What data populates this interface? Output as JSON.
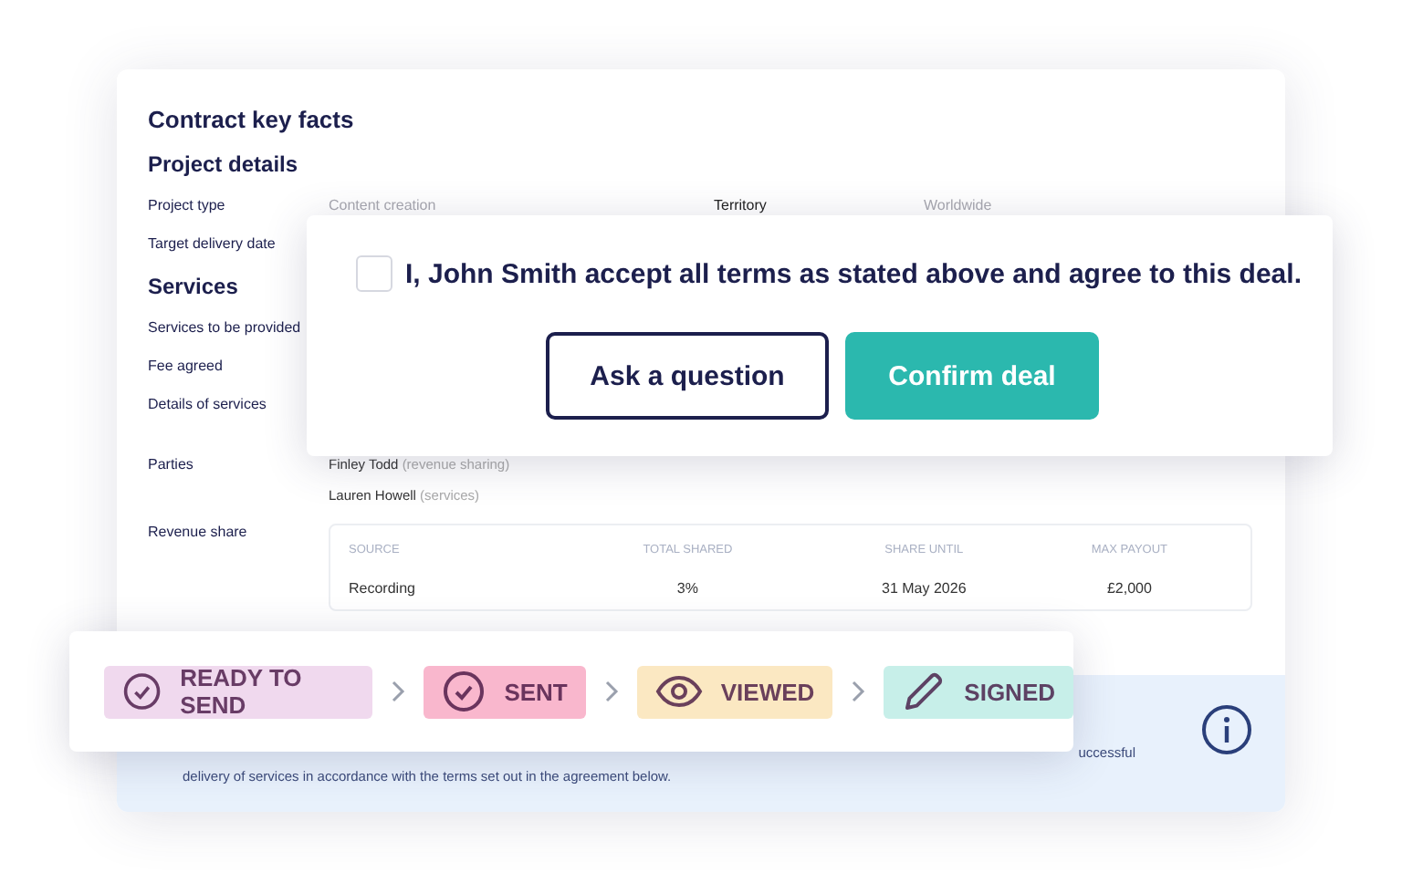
{
  "card": {
    "title": "Contract key facts",
    "sections": [
      {
        "heading": "Project details",
        "rows": [
          {
            "label": "Project type",
            "value": "Content creation",
            "extra_label": "Territory",
            "extra_value": "Worldwide"
          },
          {
            "label": "Target delivery date"
          }
        ]
      },
      {
        "heading": "Services",
        "rows": [
          {
            "label": "Services to be provided"
          },
          {
            "label": "Fee agreed"
          },
          {
            "label": "Details of services"
          }
        ]
      }
    ],
    "parties_label": "Parties",
    "parties": [
      {
        "name": "Finley Todd",
        "role": "(revenue sharing)"
      },
      {
        "name": "Lauren Howell",
        "role": "(services)"
      }
    ],
    "revenue_label": "Revenue share",
    "revenue_table": {
      "columns": [
        "SOURCE",
        "TOTAL SHARED",
        "SHARE UNTIL",
        "MAX PAYOUT"
      ],
      "rows": [
        [
          "Recording",
          "3%",
          "31 May 2026",
          "£2,000"
        ]
      ]
    },
    "info": {
      "line_end": "uccessful",
      "line": "delivery of services in accordance with the terms set out in the agreement below."
    }
  },
  "accept_dialog": {
    "checked": false,
    "statement": "I, John Smith accept all terms as stated above and agree to this deal.",
    "buttons": [
      {
        "label": "Ask a question",
        "kind": "outline"
      },
      {
        "label": "Confirm deal",
        "kind": "primary"
      }
    ]
  },
  "status_steps": [
    {
      "label": "READY TO SEND",
      "kind": "check",
      "color": "#f0d9ee"
    },
    {
      "label": "SENT",
      "kind": "check",
      "color": "#f9b7cd"
    },
    {
      "label": "VIEWED",
      "kind": "eye",
      "color": "#fbe8c2"
    },
    {
      "label": "SIGNED",
      "kind": "pencil",
      "color": "#c7efe9"
    }
  ]
}
